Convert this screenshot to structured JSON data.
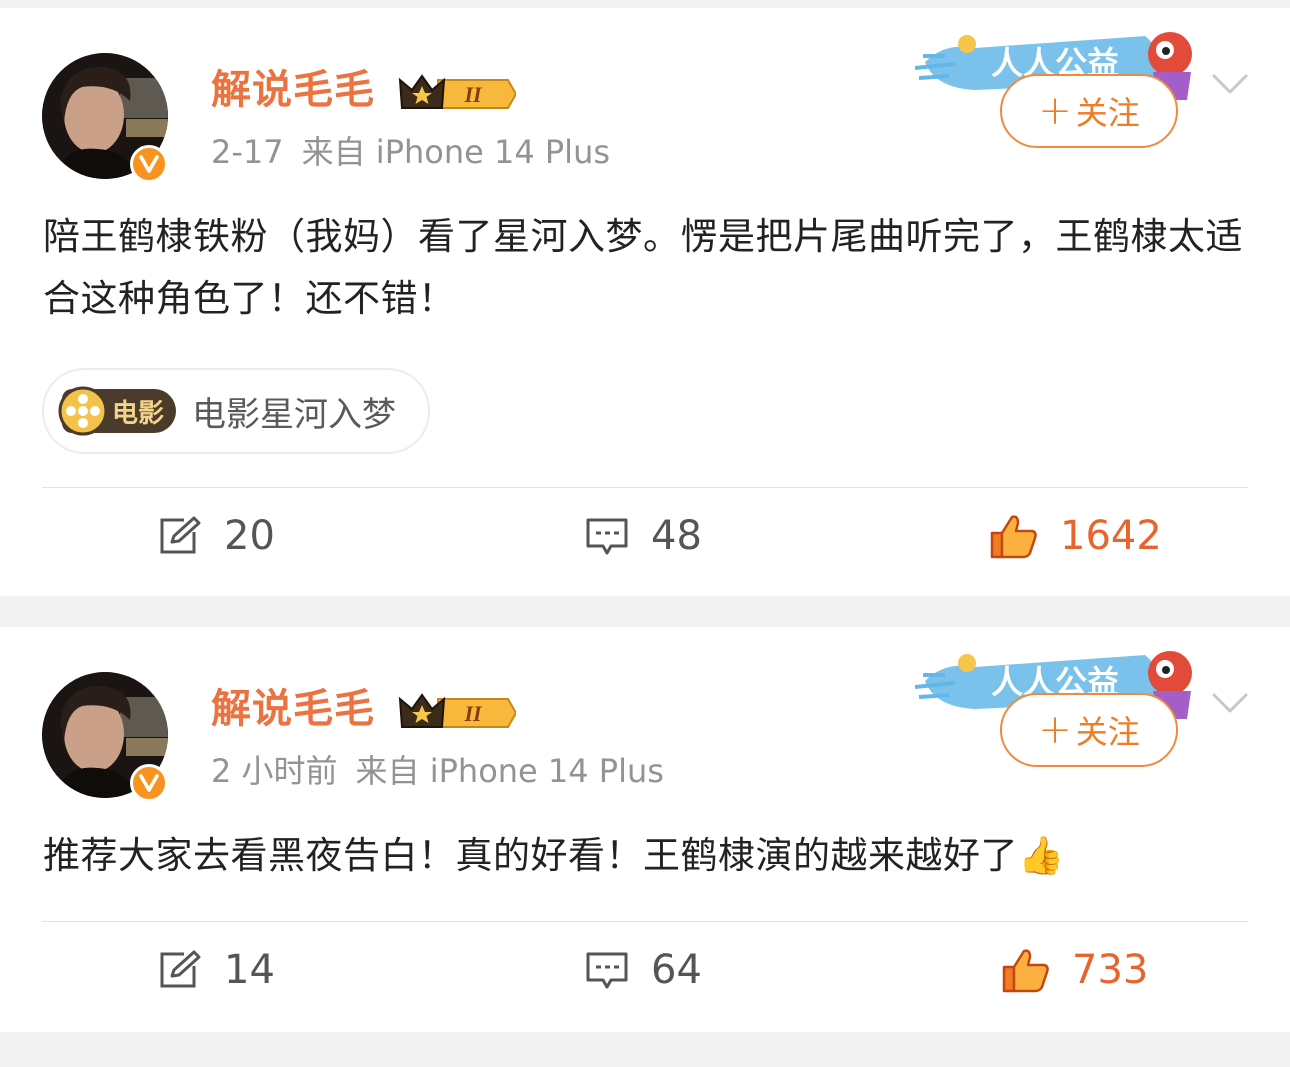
{
  "posts": [
    {
      "username": "解说毛毛",
      "level_badge": "II",
      "date": "2-17",
      "source": "来自 iPhone 14 Plus",
      "promo_badge": "人人公益",
      "follow_label": "关注",
      "text": "陪王鹤棣铁粉（我妈）看了星河入梦。愣是把片尾曲听完了，王鹤棣太适合这种角色了！还不错！",
      "topic": {
        "tag": "电影",
        "title": "电影星河入梦"
      },
      "reposts": "20",
      "comments": "48",
      "likes": "1642"
    },
    {
      "username": "解说毛毛",
      "level_badge": "II",
      "date": "2 小时前",
      "source": "来自 iPhone 14 Plus",
      "promo_badge": "人人公益",
      "follow_label": "关注",
      "text": "推荐大家去看黑夜告白！真的好看！王鹤棣演的越来越好了👍",
      "reposts": "14",
      "comments": "64",
      "likes": "733"
    }
  ],
  "colors": {
    "username": "#eb7340",
    "accent": "#f07c24",
    "like": "#e8642d",
    "meta": "#939393",
    "verified": "#f7931e"
  },
  "icons": {
    "repost": "edit-square-icon",
    "comment": "comment-bubble-icon",
    "like": "thumbs-up-icon",
    "more": "chevron-down-icon",
    "verified": "verified-v-icon",
    "crown": "crown-icon",
    "topic": "film-reel-icon"
  }
}
